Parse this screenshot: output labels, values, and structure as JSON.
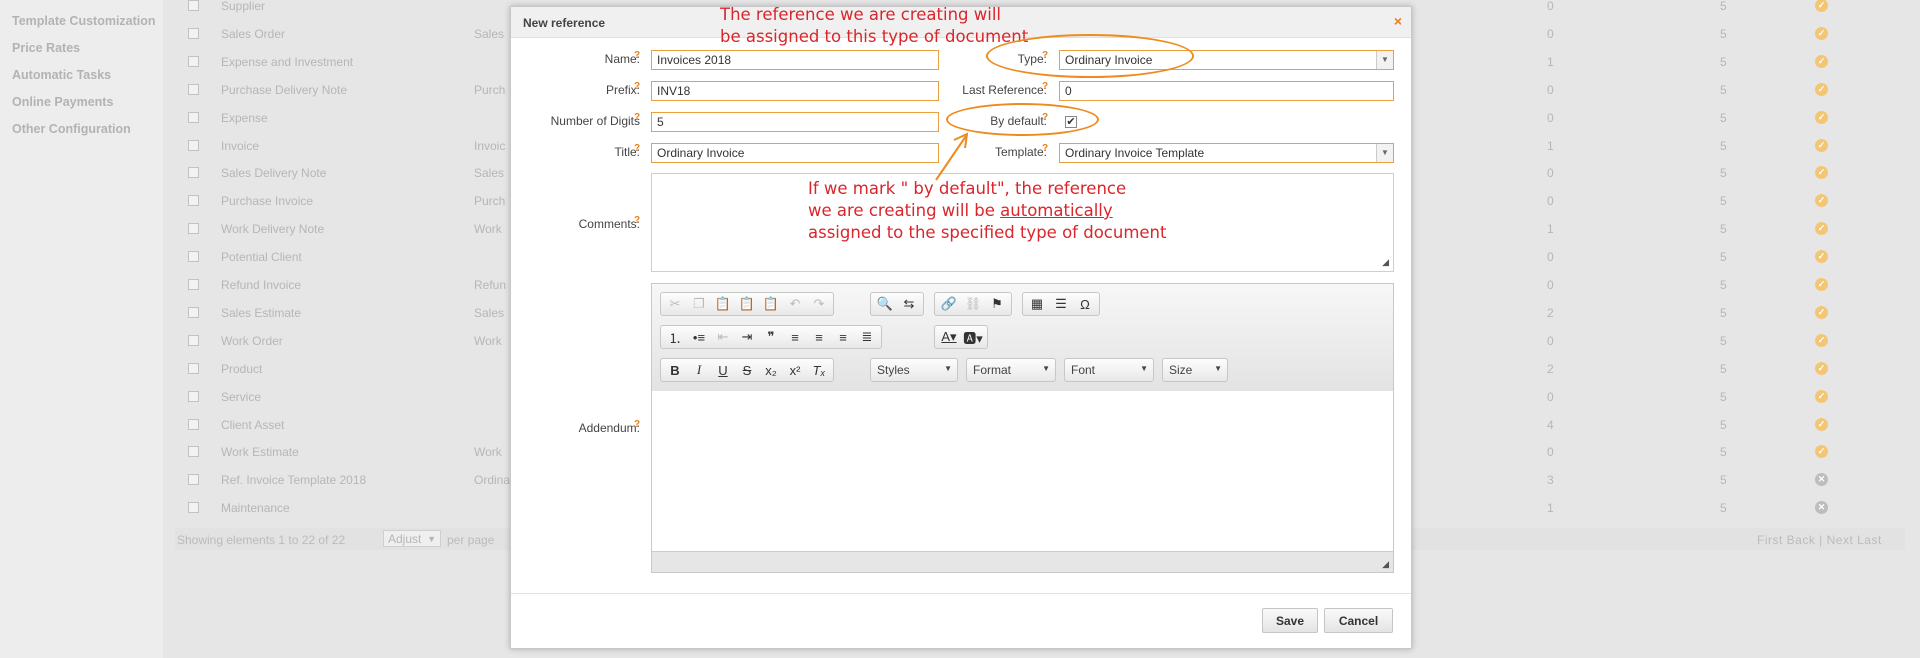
{
  "sidebar": {
    "items": [
      {
        "label": "Template Customization"
      },
      {
        "label": "Price Rates"
      },
      {
        "label": "Automatic Tasks"
      },
      {
        "label": "Online Payments"
      },
      {
        "label": "Other Configuration"
      }
    ]
  },
  "background_table": {
    "rows": [
      {
        "name": "Supplier",
        "type": "",
        "c1": "0",
        "c2": "5",
        "status": "check"
      },
      {
        "name": "Sales Order",
        "type": "Sales",
        "c1": "0",
        "c2": "5",
        "status": "check"
      },
      {
        "name": "Expense and Investment",
        "type": "",
        "c1": "1",
        "c2": "5",
        "status": "check"
      },
      {
        "name": "Purchase Delivery Note",
        "type": "Purch",
        "c1": "0",
        "c2": "5",
        "status": "check"
      },
      {
        "name": "Expense",
        "type": "",
        "c1": "0",
        "c2": "5",
        "status": "check"
      },
      {
        "name": "Invoice",
        "type": "Invoic",
        "c1": "1",
        "c2": "5",
        "status": "check"
      },
      {
        "name": "Sales Delivery Note",
        "type": "Sales",
        "c1": "0",
        "c2": "5",
        "status": "check"
      },
      {
        "name": "Purchase Invoice",
        "type": "Purch",
        "c1": "0",
        "c2": "5",
        "status": "check"
      },
      {
        "name": "Work Delivery Note",
        "type": "Work",
        "c1": "1",
        "c2": "5",
        "status": "check"
      },
      {
        "name": "Potential Client",
        "type": "",
        "c1": "0",
        "c2": "5",
        "status": "check"
      },
      {
        "name": "Refund Invoice",
        "type": "Refun",
        "c1": "0",
        "c2": "5",
        "status": "check"
      },
      {
        "name": "Sales Estimate",
        "type": "Sales",
        "c1": "2",
        "c2": "5",
        "status": "check"
      },
      {
        "name": "Work Order",
        "type": "Work",
        "c1": "0",
        "c2": "5",
        "status": "check"
      },
      {
        "name": "Product",
        "type": "",
        "c1": "2",
        "c2": "5",
        "status": "check"
      },
      {
        "name": "Service",
        "type": "",
        "c1": "0",
        "c2": "5",
        "status": "check"
      },
      {
        "name": "Client Asset",
        "type": "",
        "c1": "4",
        "c2": "5",
        "status": "check"
      },
      {
        "name": "Work Estimate",
        "type": "Work",
        "c1": "0",
        "c2": "5",
        "status": "check"
      },
      {
        "name": "Ref. Invoice Template 2018",
        "type": "Ordina",
        "c1": "3",
        "c2": "5",
        "status": "x"
      },
      {
        "name": "Maintenance",
        "type": "",
        "c1": "1",
        "c2": "5",
        "status": "x"
      }
    ],
    "footer": {
      "showing": "Showing elements 1 to 22 of 22",
      "adjust": "Adjust",
      "per_page": "per page",
      "pager": "First  Back  |  Next  Last"
    }
  },
  "dialog": {
    "title": "New reference",
    "close_symbol": "×",
    "fields": {
      "name_label": "Name:",
      "name_value": "Invoices 2018",
      "prefix_label": "Prefix:",
      "prefix_value": "INV18",
      "digits_label": "Number of Digits",
      "digits_value": "5",
      "title_label": "Title:",
      "title_value": "Ordinary Invoice",
      "type_label": "Type:",
      "type_value": "Ordinary Invoice",
      "last_ref_label": "Last Reference:",
      "last_ref_value": "0",
      "default_label": "By default:",
      "default_checked": true,
      "template_label": "Template:",
      "template_value": "Ordinary Invoice Template",
      "comments_label": "Comments:",
      "addendum_label": "Addendum:"
    },
    "help_mark": "?",
    "editor": {
      "combos": {
        "styles": "Styles",
        "format": "Format",
        "font": "Font",
        "size": "Size"
      },
      "toolbar_icons": [
        "cut-icon",
        "copy-icon",
        "paste-icon",
        "paste-text-icon",
        "paste-word-icon",
        "undo-icon",
        "redo-icon",
        "find-icon",
        "replace-icon",
        "link-icon",
        "unlink-icon",
        "anchor-icon",
        "table-icon",
        "horizontal-rule-icon",
        "special-char-icon",
        "numbered-list-icon",
        "bulleted-list-icon",
        "outdent-icon",
        "indent-icon",
        "blockquote-icon",
        "align-left-icon",
        "align-center-icon",
        "align-right-icon",
        "justify-icon",
        "text-color-icon",
        "background-color-icon",
        "bold-icon",
        "italic-icon",
        "underline-icon",
        "strikethrough-icon",
        "subscript-icon",
        "superscript-icon",
        "remove-format-icon"
      ]
    },
    "buttons": {
      "save": "Save",
      "cancel": "Cancel"
    }
  },
  "annotations": {
    "top_line1": "The reference we are creating will",
    "top_line2": "be assigned to this type of document",
    "mid_line1": "If we mark \" by default\", the reference",
    "mid_line2_a": "we are creating will be ",
    "mid_line2_b": "automatically ",
    "mid_line3": "assigned to the specified type of document",
    "highlight_color": "#ee8b1e",
    "text_color": "#d9262b"
  }
}
